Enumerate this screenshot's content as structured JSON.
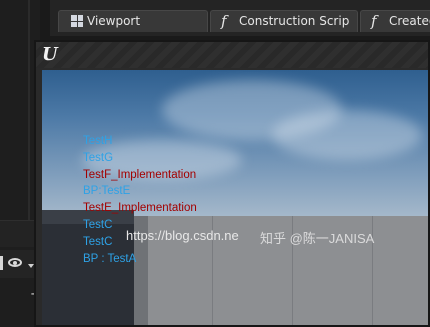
{
  "tabs": [
    {
      "label": "Viewport",
      "icon": "viewport-grid-icon"
    },
    {
      "label": "Construction Scrip",
      "icon": "function-icon"
    },
    {
      "label": "Created",
      "icon": "function-icon"
    }
  ],
  "viewport": {
    "logo": "U",
    "log_lines": [
      {
        "text": "TestH",
        "color": "#2ea2e6"
      },
      {
        "text": "TestG",
        "color": "#2ea2e6"
      },
      {
        "text": "TestF_Implementation",
        "color": "#a30000"
      },
      {
        "text": "BP:TestE",
        "color": "#2ea2e6"
      },
      {
        "text": "TestE_Implementation",
        "color": "#a30000"
      },
      {
        "text": "TestC",
        "color": "#2ea2e6"
      },
      {
        "text": "TestC",
        "color": "#2ea2e6"
      },
      {
        "text": "BP : TestA",
        "color": "#2ea2e6"
      }
    ]
  },
  "watermark": {
    "url": "https://blog.csdn.ne",
    "overlay": "知乎 @陈一JANISA"
  }
}
